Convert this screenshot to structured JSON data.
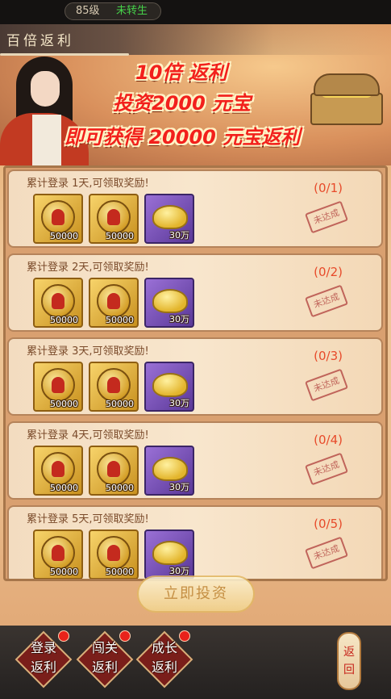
{
  "status": {
    "level": "85级",
    "rebirth": "未转生"
  },
  "banner": {
    "title": "百倍返利",
    "line1": "10倍 返利",
    "line2": "投资2000 元宝",
    "line3": "即可获得 20000 元宝返利"
  },
  "cards": [
    {
      "label": "累计登录 1天,可领取奖励!",
      "progress": "(0/1)",
      "stamp": "未达成",
      "rewards": [
        "50000",
        "50000",
        "30万"
      ]
    },
    {
      "label": "累计登录 2天,可领取奖励!",
      "progress": "(0/2)",
      "stamp": "未达成",
      "rewards": [
        "50000",
        "50000",
        "30万"
      ]
    },
    {
      "label": "累计登录 3天,可领取奖励!",
      "progress": "(0/3)",
      "stamp": "未达成",
      "rewards": [
        "50000",
        "50000",
        "30万"
      ]
    },
    {
      "label": "累计登录 4天,可领取奖励!",
      "progress": "(0/4)",
      "stamp": "未达成",
      "rewards": [
        "50000",
        "50000",
        "30万"
      ]
    },
    {
      "label": "累计登录 5天,可领取奖励!",
      "progress": "(0/5)",
      "stamp": "未达成",
      "rewards": [
        "50000",
        "50000",
        "30万"
      ]
    }
  ],
  "invest_button": "立即投资",
  "tabs": [
    {
      "label1": "登录",
      "label2": "返利"
    },
    {
      "label1": "闯关",
      "label2": "返利"
    },
    {
      "label1": "成长",
      "label2": "返利"
    }
  ],
  "back_button": {
    "line1": "返",
    "line2": "回"
  }
}
